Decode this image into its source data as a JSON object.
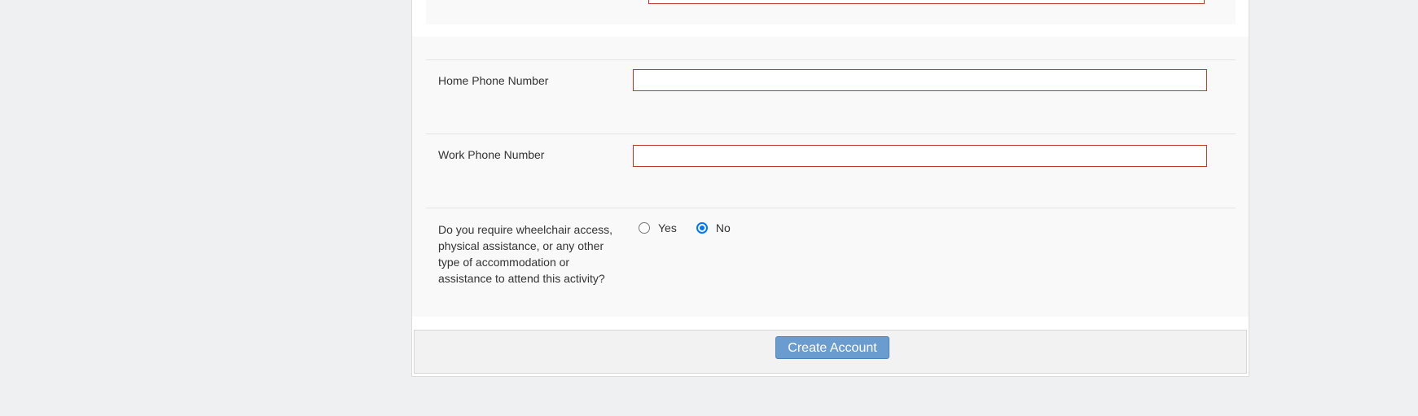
{
  "form": {
    "home_phone": {
      "label": "Home Phone Number",
      "value": "",
      "placeholder": ""
    },
    "work_phone": {
      "label": "Work Phone Number",
      "value": "",
      "placeholder": ""
    },
    "accommodation": {
      "question": "Do you require wheelchair access, physical assistance, or any other type of accommodation or assistance to attend this activity?",
      "options": [
        {
          "label": "Yes",
          "checked": false
        },
        {
          "label": "No",
          "checked": true
        }
      ]
    }
  },
  "footer": {
    "create_account_label": "Create Account"
  },
  "colors": {
    "invalid_border": "#c0392b",
    "button_bg": "#6a9ccf",
    "radio_checked": "#0075ff",
    "page_bg": "#eef0f2"
  }
}
